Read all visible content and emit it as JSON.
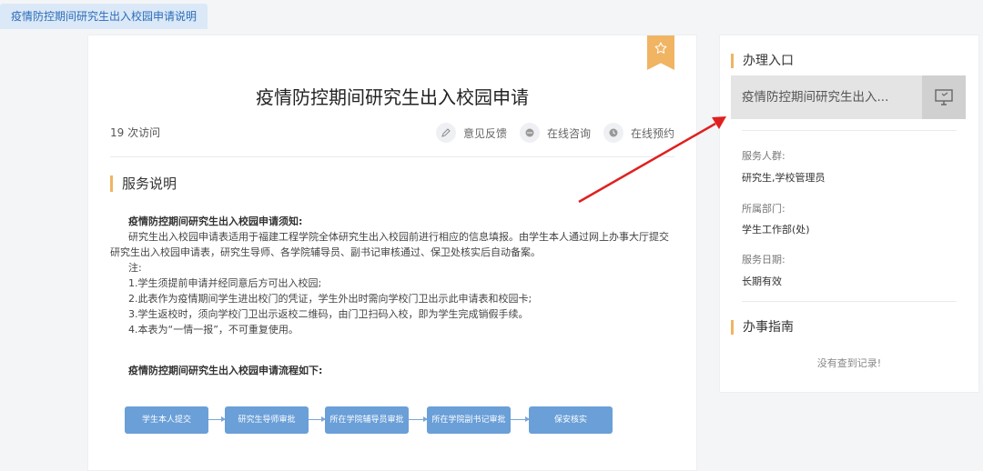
{
  "tab": {
    "label": "疫情防控期间研究生出入校园申请说明"
  },
  "main": {
    "title": "疫情防控期间研究生出入校园申请",
    "visits": "19 次访问",
    "actions": [
      {
        "label": "意见反馈",
        "icon": "pencil-icon"
      },
      {
        "label": "在线咨询",
        "icon": "chat-icon"
      },
      {
        "label": "在线预约",
        "icon": "clock-icon"
      }
    ],
    "section_title": "服务说明",
    "notice_heading": "疫情防控期间研究生出入校园申请须知:",
    "paragraph": "研究生出入校园申请表适用于福建工程学院全体研究生出入校园前进行相应的信息填报。由学生本人通过网上办事大厅提交研究生出入校园申请表，研究生导师、各学院辅导员、副书记审核通过、保卫处核实后自动备案。",
    "note_label": "注:",
    "notes": [
      "1.学生须提前申请并经同意后方可出入校园;",
      "2.此表作为疫情期间学生进出校门的凭证，学生外出时需向学校门卫出示此申请表和校园卡;",
      "3.学生返校时，须向学校门卫出示返校二维码，由门卫扫码入校，即为学生完成销假手续。",
      "4.本表为“一情一报”，不可重复使用。"
    ],
    "flow_heading": "疫情防控期间研究生出入校园申请流程如下:",
    "flow_steps": [
      "学生本人提交",
      "研究生导师审批",
      "所在学院辅导员审批",
      "所在学院副书记审批",
      "保安核实"
    ]
  },
  "sidebar": {
    "entry_title": "办理入口",
    "entry_text": "疫情防控期间研究生出入...",
    "service_group_label": "服务人群:",
    "service_group_value": "研究生,学校管理员",
    "department_label": "所属部门:",
    "department_value": "学生工作部(处)",
    "date_label": "服务日期:",
    "date_value": "长期有效",
    "guide_title": "办事指南",
    "empty_text": "没有查到记录!"
  },
  "colors": {
    "accent": "#f0b463",
    "link": "#2b6cb8",
    "flow_box": "#6a9fd8",
    "annotation_arrow": "#e02020"
  }
}
